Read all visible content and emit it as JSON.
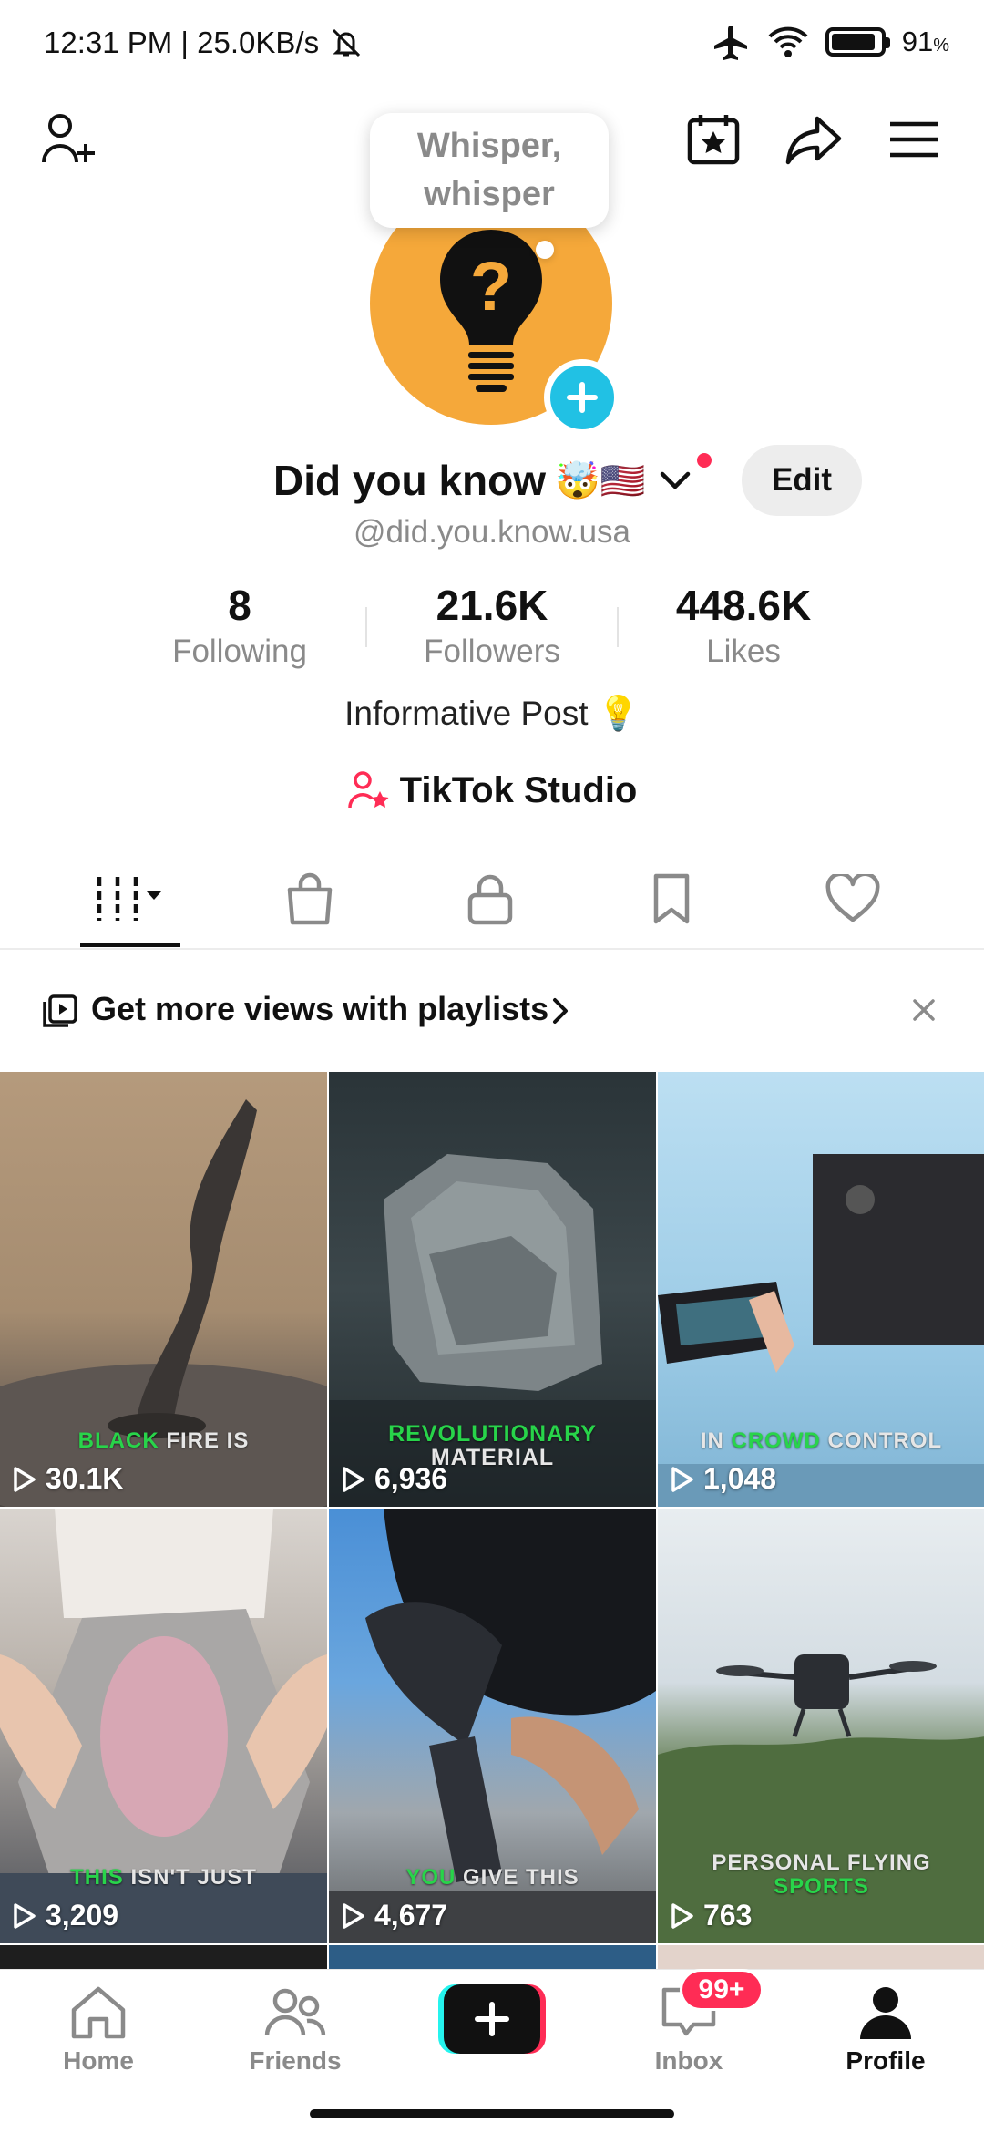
{
  "status_bar": {
    "time_speed": "12:31 PM | 25.0KB/s",
    "battery_percent": "91",
    "battery_unit": "%",
    "battery_level": 0.91
  },
  "tooltip": {
    "text": "Whisper, whisper"
  },
  "profile": {
    "display_name": "Did you know",
    "name_emojis": "🤯🇺🇸",
    "username": "@did.you.know.usa",
    "edit_label": "Edit",
    "bio": "Informative Post 💡",
    "studio_label": "TikTok Studio"
  },
  "stats": [
    {
      "value": "8",
      "label": "Following"
    },
    {
      "value": "21.6K",
      "label": "Followers"
    },
    {
      "value": "448.6K",
      "label": "Likes"
    }
  ],
  "tabs": [
    "videos-tab",
    "shop-tab",
    "private-tab",
    "saved-tab",
    "liked-tab"
  ],
  "playlist_banner": {
    "text": "Get more views with playlists"
  },
  "videos": [
    {
      "caption_green": "BLACK",
      "caption_rest": " FIRE IS",
      "views": "30.1K"
    },
    {
      "caption_green": "REVOLUTIONARY",
      "caption_rest": "MATERIAL",
      "views": "6,936"
    },
    {
      "caption_pre": "IN ",
      "caption_green": "CROWD",
      "caption_rest": " CONTROL",
      "views": "1,048"
    },
    {
      "caption_green": "THIS",
      "caption_rest": " ISN'T JUST",
      "views": "3,209"
    },
    {
      "caption_green": "YOU",
      "caption_rest": " GIVE THIS",
      "views": "4,677"
    },
    {
      "caption_pre": "PERSONAL FLYING",
      "caption_green": "SPORTS",
      "views": "763"
    }
  ],
  "bottom_nav": {
    "home": "Home",
    "friends": "Friends",
    "inbox": "Inbox",
    "inbox_badge": "99+",
    "profile": "Profile"
  }
}
